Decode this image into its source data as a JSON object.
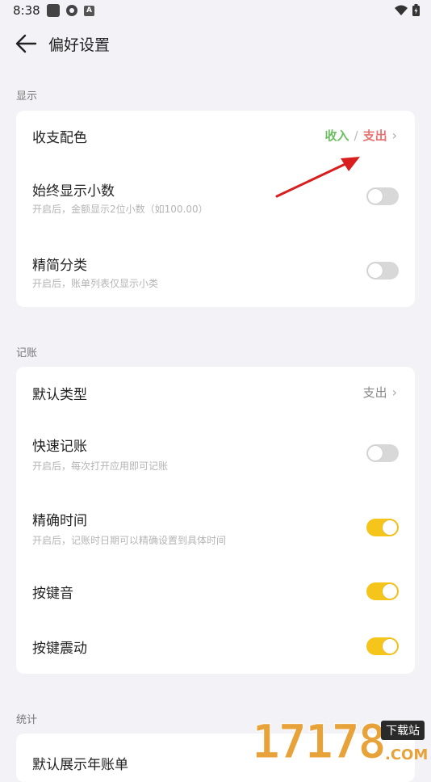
{
  "status_bar": {
    "time": "8:38"
  },
  "header": {
    "title": "偏好设置"
  },
  "sections": {
    "display": "显示",
    "bookkeeping": "记账",
    "stats": "统计"
  },
  "display_card": {
    "color_row": {
      "title": "收支配色",
      "income": "收入",
      "sep": "/",
      "expense": "支出"
    },
    "decimal_row": {
      "title": "始终显示小数",
      "sub": "开启后，金额显示2位小数（如100.00）",
      "on": false
    },
    "simple_row": {
      "title": "精简分类",
      "sub": "开启后，账单列表仅显示小类",
      "on": false
    }
  },
  "bookkeeping_card": {
    "default_type_row": {
      "title": "默认类型",
      "value": "支出"
    },
    "quick_row": {
      "title": "快速记账",
      "sub": "开启后，每次打开应用即可记账",
      "on": false
    },
    "precise_row": {
      "title": "精确时间",
      "sub": "开启后，记账时日期可以精确设置到具体时间",
      "on": true
    },
    "key_sound_row": {
      "title": "按键音",
      "on": true
    },
    "key_vibrate_row": {
      "title": "按键震动",
      "on": true
    }
  },
  "stats_card": {
    "year_row": {
      "title": "默认展示年账单"
    }
  },
  "watermark": {
    "number": "17178",
    "tag": "下载站",
    "com": ".COM"
  },
  "colors": {
    "accent": "#f5c51b",
    "income": "#6cc060",
    "expense": "#e57373",
    "background": "#f2f2f7"
  }
}
